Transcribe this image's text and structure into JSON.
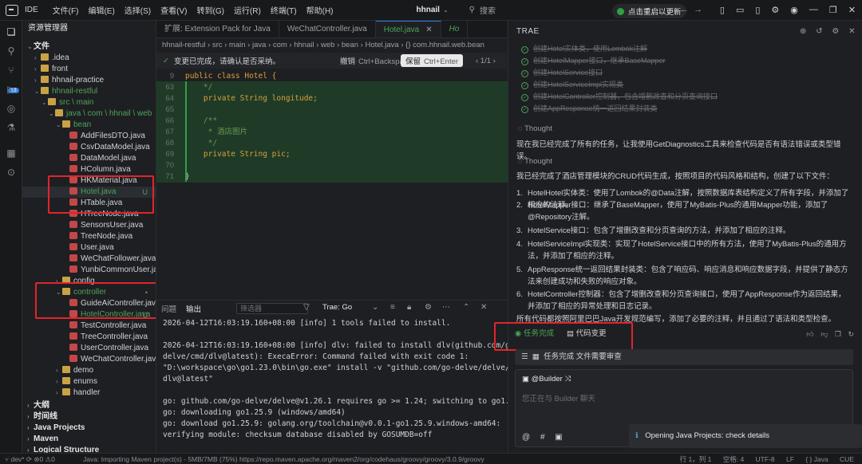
{
  "titlebar": {
    "ide": "IDE",
    "menu": [
      "文件(F)",
      "编辑(E)",
      "选择(S)",
      "查看(V)",
      "转到(G)",
      "运行(R)",
      "终端(T)",
      "帮助(H)"
    ],
    "project": "hhnail",
    "search_placeholder": "搜索",
    "update_label": "点击重启以更新"
  },
  "explorer": {
    "title": "资源管理器",
    "section_files": "文件",
    "rows": [
      {
        "label": "文件",
        "type": "section",
        "indent": 0
      },
      {
        "label": ".idea",
        "type": "folder",
        "indent": 1,
        "arrow": "›"
      },
      {
        "label": "front",
        "type": "folder",
        "indent": 1,
        "arrow": "›"
      },
      {
        "label": "hhnail-practice",
        "type": "folder",
        "indent": 1,
        "arrow": "›"
      },
      {
        "label": "hhnail-restful",
        "type": "folder",
        "indent": 1,
        "arrow": "⌄",
        "green": true
      },
      {
        "label": "src \\ main",
        "type": "folder",
        "indent": 2,
        "arrow": "⌄",
        "green": true
      },
      {
        "label": "java \\ com \\ hhnail \\ web",
        "type": "folder",
        "indent": 3,
        "arrow": "⌄",
        "green": true
      },
      {
        "label": "bean",
        "type": "folder",
        "indent": 4,
        "arrow": "⌄",
        "green": true
      },
      {
        "label": "AddFilesDTO.java",
        "type": "java",
        "indent": 5
      },
      {
        "label": "CsvDataModel.java",
        "type": "java",
        "indent": 5
      },
      {
        "label": "DataModel.java",
        "type": "java",
        "indent": 5
      },
      {
        "label": "HColumn.java",
        "type": "java",
        "indent": 5
      },
      {
        "label": "HKMaterial.java",
        "type": "java",
        "indent": 5
      },
      {
        "label": "Hotel.java",
        "type": "java",
        "indent": 5,
        "green": true,
        "sel": true,
        "u": "U"
      },
      {
        "label": "HTable.java",
        "type": "java",
        "indent": 5
      },
      {
        "label": "HTreeNode.java",
        "type": "java",
        "indent": 5
      },
      {
        "label": "SensorsUser.java",
        "type": "java",
        "indent": 5
      },
      {
        "label": "TreeNode.java",
        "type": "java",
        "indent": 5
      },
      {
        "label": "User.java",
        "type": "java",
        "indent": 5
      },
      {
        "label": "WeChatFollower.java",
        "type": "java",
        "indent": 5
      },
      {
        "label": "YunbiCommonUser.java",
        "type": "java",
        "indent": 5
      },
      {
        "label": "config",
        "type": "folder",
        "indent": 4,
        "arrow": "›"
      },
      {
        "label": "controller",
        "type": "folder",
        "indent": 4,
        "arrow": "⌄",
        "green": true,
        "u": "•"
      },
      {
        "label": "GuideAiController.java",
        "type": "java",
        "indent": 5
      },
      {
        "label": "HotelController.java",
        "type": "java",
        "indent": 5,
        "green": true,
        "u": "U"
      },
      {
        "label": "TestController.java",
        "type": "java",
        "indent": 5
      },
      {
        "label": "TreeController.java",
        "type": "java",
        "indent": 5
      },
      {
        "label": "UserController.java",
        "type": "java",
        "indent": 5
      },
      {
        "label": "WeChatController.java",
        "type": "java",
        "indent": 5
      },
      {
        "label": "demo",
        "type": "folder",
        "indent": 4,
        "arrow": "›"
      },
      {
        "label": "enums",
        "type": "folder",
        "indent": 4,
        "arrow": "›"
      },
      {
        "label": "handler",
        "type": "folder",
        "indent": 4,
        "arrow": "›"
      },
      {
        "label": "大纲",
        "type": "section",
        "indent": 0
      },
      {
        "label": "时间线",
        "type": "section",
        "indent": 0
      },
      {
        "label": "Java Projects",
        "type": "section",
        "indent": 0
      },
      {
        "label": "Maven",
        "type": "section",
        "indent": 0
      },
      {
        "label": "Logical Structure",
        "type": "section",
        "indent": 0
      }
    ]
  },
  "editor": {
    "tabs": [
      {
        "label": "扩展: Extension Pack for Java",
        "active": false
      },
      {
        "label": "WeChatController.java",
        "active": false
      },
      {
        "label": "Hotel.java",
        "active": true
      },
      {
        "label": "Ho",
        "active": false
      }
    ],
    "breadcrumbs": "hhnail-restful  ›  src  ›  main  ›  java  ›  com  ›  hhnail  ›  web  ›  bean  ›  Hotel.java  ›  {} com.hhnail.web.bean",
    "notice": "变更已完成，请确认是否采纳。",
    "reject_label": "撤销",
    "reject_key": "Ctrl+Backspace",
    "accept_label": "保留",
    "accept_key": "Ctrl+Enter",
    "pager": "1/1",
    "lines": [
      {
        "n": "9",
        "text": "public class Hotel {",
        "kind": "decl",
        "added": false
      },
      {
        "n": "63",
        "text": "    */",
        "kind": "comment",
        "added": true
      },
      {
        "n": "64",
        "text": "    private String longitude;",
        "kind": "field",
        "added": true
      },
      {
        "n": "65",
        "text": "",
        "kind": "plain",
        "added": true
      },
      {
        "n": "66",
        "text": "    /**",
        "kind": "comment",
        "added": true
      },
      {
        "n": "67",
        "text": "     * 酒店图片",
        "kind": "comment",
        "added": true
      },
      {
        "n": "68",
        "text": "     */",
        "kind": "comment",
        "added": true
      },
      {
        "n": "69",
        "text": "    private String pic;",
        "kind": "field",
        "added": true
      },
      {
        "n": "70",
        "text": "",
        "kind": "plain",
        "added": true
      },
      {
        "n": "71",
        "text": "}",
        "kind": "plain",
        "added": true
      }
    ]
  },
  "terminal": {
    "tabs": [
      "问题",
      "输出"
    ],
    "filter_placeholder": "筛选器",
    "task": "Trae: Go",
    "lines": [
      "2026-04-12T16:03:19.160+08:00 [info] 1 tools failed to install.",
      "",
      "2026-04-12T16:03:19.160+08:00 [info] dlv: failed to install dlv(github.com/go-delve/",
      "delve/cmd/dlv@latest): ExecaError: Command failed with exit code 1:",
      "\"D:\\workspace\\go\\go1.23.0\\bin\\go.exe\" install -v \"github.com/go-delve/delve/cmd/",
      "dlv@latest\"",
      "",
      "go: github.com/go-delve/delve@v1.26.1 requires go >= 1.24; switching to go1.25.9",
      "go: downloading go1.25.9 (windows/amd64)",
      "go: download go1.25.9: golang.org/toolchain@v0.0.1-go1.25.9.windows-amd64:",
      "verifying module: checksum database disabled by GOSUMDB=off"
    ]
  },
  "ai": {
    "title": "TRAE",
    "todos": [
      "创建Hotel实体类，使用Lombok注解",
      "创建HotelMapper接口，继承BaseMapper",
      "创建HotelService接口",
      "创建HotelServiceImpl实现类",
      "创建HotelController控制器，包含增删改查和分页查询接口",
      "创建AppResponse统一返回结果封装类"
    ],
    "thought1": "Thought",
    "para1": "现在我已经完成了所有的任务，让我使用GetDiagnostics工具来检查代码是否有语法错误或类型错误。",
    "thought2": "Thought",
    "para2": "我已经完成了酒店管理模块的CRUD代码生成，按照项目的代码风格和结构，创建了以下文件：",
    "items": [
      "HotelHotel实体类：使用了Lombok的@Data注解，按照数据库表结构定义了所有字段，并添加了相应的注释。",
      "HotelMapper接口：继承了BaseMapper，使用了MyBatis-Plus的通用Mapper功能，添加了@Repository注解。",
      "HotelService接口：包含了增删改查和分页查询的方法，并添加了相应的注释。",
      "HotelServiceImpl实现类：实现了HotelService接口中的所有方法，使用了MyBatis-Plus的通用方法，并添加了相应的注释。",
      "AppResponse统一返回结果封装类：包含了响应码、响应消息和响应数据字段，并提供了静态方法来创建成功和失败的响应对象。",
      "HotelController控制器：包含了增删改查和分页查询接口，使用了AppResponse作为返回结果，并添加了相应的异常处理和日志记录。"
    ],
    "para3": "所有代码都按照阿里巴巴Java开发规范编写，添加了必要的注释，并且通过了语法和类型检查。",
    "status_done": "任务完成",
    "status_changes": "代码变更",
    "tasks_bar": "任务完成  文件需要审查",
    "agent": "@Builder",
    "input_placeholder": "您正在与 Builder 聊天"
  },
  "toast": "Opening Java Projects: check details",
  "statusbar": {
    "left": "dev*",
    "mid": "Java: Importing Maven project(s) - 5MB/7MB (75%) https://repo.maven.apache.org/maven2/org/codehaus/groovy/groovy/3.0.9/groovy",
    "right": [
      "行 1，列 1",
      "空格: 4",
      "UTF-8",
      "LF",
      "{ } Java",
      "CUE"
    ]
  }
}
